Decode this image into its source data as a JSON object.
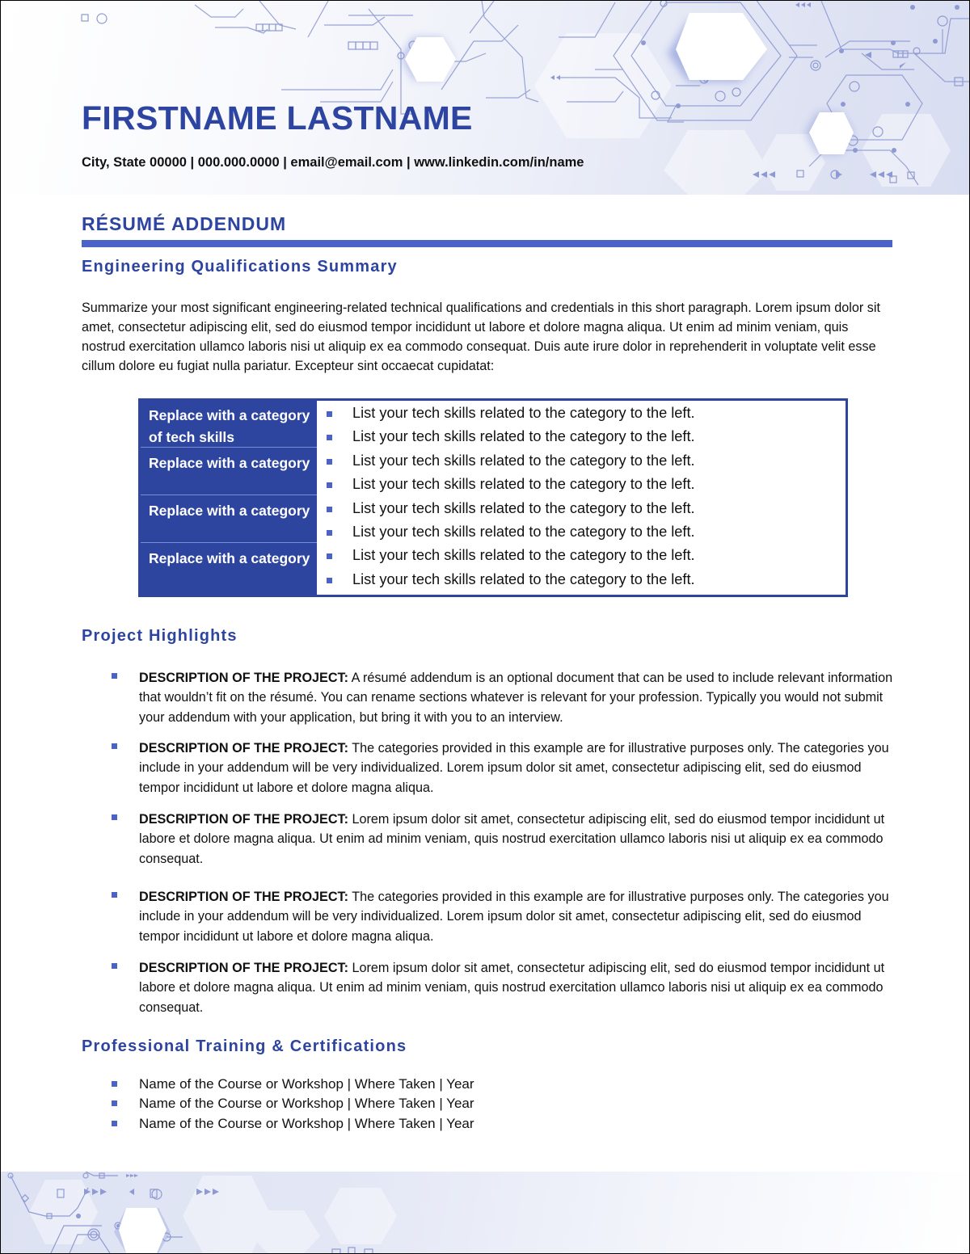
{
  "header": {
    "name": "FIRSTNAME LASTNAME",
    "contact": "City, State 00000 | 000.000.0000 | email@email.com | www.linkedin.com/in/name"
  },
  "document_title": "RÉSUMÉ ADDENDUM",
  "colors": {
    "accent": "#2d44a0",
    "rule": "#4b63c6",
    "table_fill": "#2e45a0",
    "bullet": "#4b63c6"
  },
  "qualifications": {
    "heading": "Engineering Qualifications Summary",
    "paragraph": "Summarize your most significant engineering-related technical qualifications and credentials in this short paragraph. Lorem ipsum dolor sit amet, consectetur adipiscing elit, sed do eiusmod tempor incididunt ut labore et dolore magna aliqua. Ut enim ad minim veniam, quis nostrud exercitation ullamco laboris nisi ut aliquip ex ea commodo consequat. Duis aute irure dolor in reprehenderit in voluptate velit esse cillum dolore eu fugiat nulla pariatur. Excepteur sint occaecat cupidatat:",
    "skills_table": {
      "categories": [
        "Replace with a category of tech skills",
        "Replace with a category",
        "Replace with a category",
        "Replace with a category"
      ],
      "items": [
        "List your tech skills related to the category to the left.",
        "List your tech skills related to the category to the left.",
        "List your tech skills related to the category to the left.",
        "List your tech skills related to the category to the left.",
        "List your tech skills related to the category to the left.",
        "List your tech skills related to the category to the left.",
        "List your tech skills related to the category to the left.",
        "List your tech skills related to the category to the left."
      ]
    }
  },
  "projects": {
    "heading": "Project Highlights",
    "items": [
      {
        "label": "DESCRIPTION OF THE PROJECT:",
        "text": " A résumé addendum is an optional document that can be used to include relevant information that wouldn’t fit on the résumé. You can rename sections whatever is relevant for your profession. Typically you would not submit your addendum with your application, but bring it with you to an interview."
      },
      {
        "label": "DESCRIPTION OF THE PROJECT:",
        "text": " The categories provided in this example are for illustrative purposes only. The categories you include in your addendum will be very individualized. Lorem ipsum dolor sit amet, consectetur adipiscing elit, sed do eiusmod tempor incididunt ut labore et dolore magna aliqua."
      },
      {
        "label": "DESCRIPTION OF THE PROJECT:",
        "text": " Lorem ipsum dolor sit amet, consectetur adipiscing elit, sed do eiusmod tempor incididunt ut labore et dolore magna aliqua. Ut enim ad minim veniam, quis nostrud exercitation ullamco laboris nisi ut aliquip ex ea commodo consequat."
      },
      {
        "label": "DESCRIPTION OF THE PROJECT:",
        "text": " The categories provided in this example are for illustrative purposes only. The categories you include in your addendum will be very individualized. Lorem ipsum dolor sit amet, consectetur adipiscing elit, sed do eiusmod tempor incididunt ut labore et dolore magna aliqua."
      },
      {
        "label": "DESCRIPTION OF THE PROJECT:",
        "text": " Lorem ipsum dolor sit amet, consectetur adipiscing elit, sed do eiusmod tempor incididunt ut labore et dolore magna aliqua. Ut enim ad minim veniam, quis nostrud exercitation ullamco laboris nisi ut aliquip ex ea commodo consequat."
      }
    ]
  },
  "certifications": {
    "heading": "Professional Training & Certifications",
    "items": [
      "Name of the Course or Workshop | Where Taken | Year",
      "Name of the Course or Workshop | Where Taken | Year",
      "Name of the Course or Workshop | Where Taken | Year"
    ]
  },
  "decorations": {
    "header_graphic": "circuit-hexagon-pattern",
    "footer_graphic": "circuit-hexagon-pattern"
  }
}
